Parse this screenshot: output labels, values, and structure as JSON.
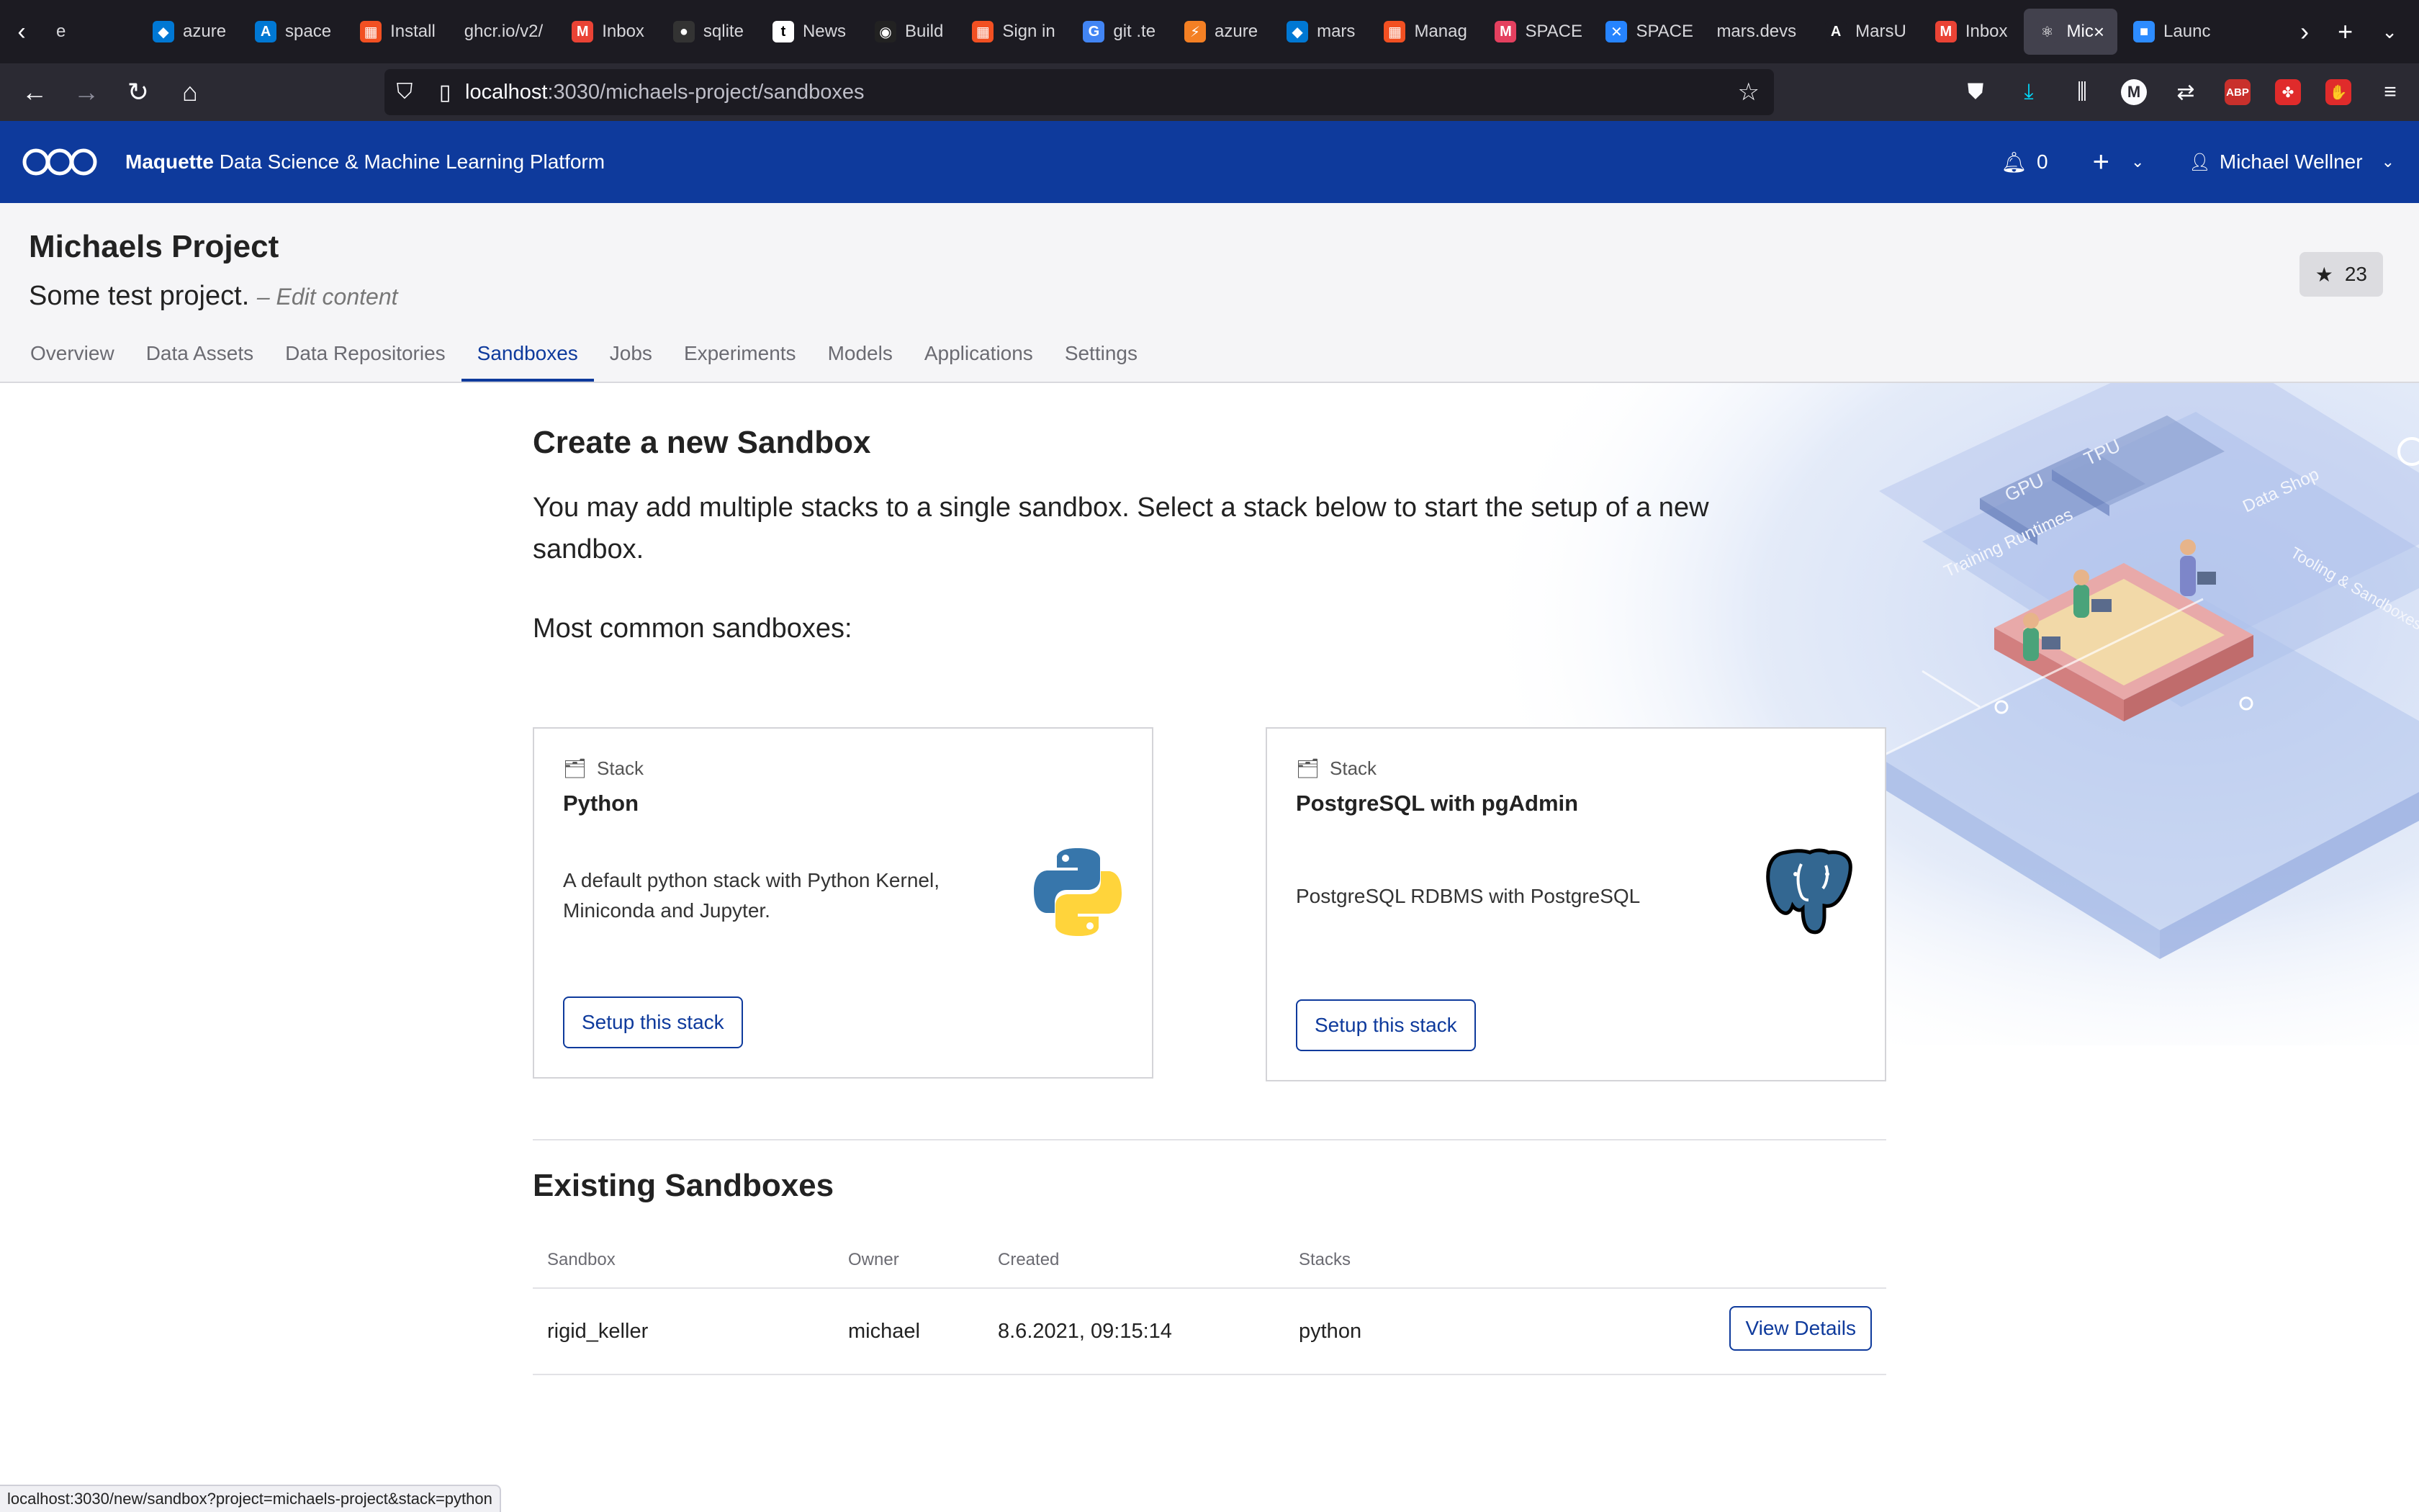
{
  "browser": {
    "tabs": [
      {
        "label": "e",
        "fav": "",
        "color": "#1c1b22"
      },
      {
        "label": "azure",
        "fav": "◆",
        "color": "#0078d4"
      },
      {
        "label": "space",
        "fav": "A",
        "color": "#0078d4"
      },
      {
        "label": "Install",
        "fav": "▦",
        "color": "#f25022"
      },
      {
        "label": "ghcr.io/v2/",
        "fav": "",
        "color": "#1c1b22"
      },
      {
        "label": "Inbox",
        "fav": "M",
        "color": "#ea4335"
      },
      {
        "label": "sqlite",
        "fav": "●",
        "color": "#333"
      },
      {
        "label": "News",
        "fav": "t",
        "color": "#fff"
      },
      {
        "label": "Build",
        "fav": "◉",
        "color": "#222"
      },
      {
        "label": "Sign in",
        "fav": "▦",
        "color": "#f25022"
      },
      {
        "label": "git .te",
        "fav": "G",
        "color": "#4285f4"
      },
      {
        "label": "azure",
        "fav": "⚡",
        "color": "#f48024"
      },
      {
        "label": "mars",
        "fav": "◆",
        "color": "#0078d4"
      },
      {
        "label": "Manag",
        "fav": "▦",
        "color": "#f25022"
      },
      {
        "label": "SPACE",
        "fav": "M",
        "color": "#e4405f"
      },
      {
        "label": "SPACE",
        "fav": "✕",
        "color": "#2684ff"
      },
      {
        "label": "mars.devs",
        "fav": "",
        "color": "#1c1b22"
      },
      {
        "label": "MarsU",
        "fav": "A",
        "color": "#1c1b22"
      },
      {
        "label": "Inbox",
        "fav": "M",
        "color": "#ea4335"
      },
      {
        "label": "Mic",
        "fav": "⚛",
        "color": "#42414d",
        "active": true
      },
      {
        "label": "Launc",
        "fav": "■",
        "color": "#2d8cff"
      }
    ],
    "url_host": "localhost",
    "url_path": ":3030/michaels-project/sandboxes",
    "status_url": "localhost:3030/new/sandbox?project=michaels-project&stack=python"
  },
  "app": {
    "brand_bold": "Maquette",
    "brand_rest": "Data Science & Machine Learning Platform",
    "notifications": "0",
    "user_name": "Michael Wellner"
  },
  "project": {
    "title": "Michaels Project",
    "description": "Some test project.",
    "edit_label": "– Edit content",
    "stars": "23",
    "tabs": [
      "Overview",
      "Data Assets",
      "Data Repositories",
      "Sandboxes",
      "Jobs",
      "Experiments",
      "Models",
      "Applications",
      "Settings"
    ],
    "active_tab": "Sandboxes"
  },
  "create": {
    "heading": "Create a new Sandbox",
    "lead": "You may add multiple stacks to a single sandbox. Select a stack below to start the setup of a new sandbox.",
    "common_heading": "Most common sandboxes:",
    "stacks": [
      {
        "kind": "Stack",
        "name": "Python",
        "description": "A default python stack with Python Kernel, Miniconda and Jupyter.",
        "button": "Setup this stack",
        "logo": "python-logo"
      },
      {
        "kind": "Stack",
        "name": "PostgreSQL with pgAdmin",
        "description": "PostgreSQL RDBMS with PostgreSQL",
        "button": "Setup this stack",
        "logo": "postgresql-logo"
      }
    ]
  },
  "existing": {
    "heading": "Existing Sandboxes",
    "columns": [
      "Sandbox",
      "Owner",
      "Created",
      "Stacks"
    ],
    "rows": [
      {
        "sandbox": "rigid_keller",
        "owner": "michael",
        "created": "8.6.2021, 09:15:14",
        "stacks": "python",
        "action": "View Details"
      }
    ]
  },
  "illustration": {
    "labels": [
      "GPU",
      "TPU",
      "Training Runtimes",
      "Data Shop",
      "Tooling & Sandboxes"
    ]
  },
  "colors": {
    "brand": "#0e3a9c",
    "browser_dark": "#1c1b22",
    "browser_toolbar": "#2b2a33"
  }
}
